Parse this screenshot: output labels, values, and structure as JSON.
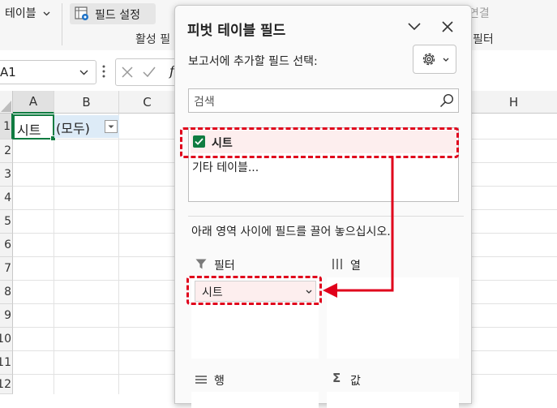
{
  "ribbon": {
    "table_dropdown_label": "테이블",
    "field_settings_label": "필드 설정",
    "active_group_label": "활성 필",
    "connect_label": "연결",
    "filter_group_label": "필터"
  },
  "formula_bar": {
    "name_box": "A1",
    "formula_prefix": "f"
  },
  "grid": {
    "columns": [
      "A",
      "B",
      "C",
      "H"
    ],
    "rows": [
      "1",
      "2",
      "3",
      "4",
      "5",
      "6",
      "7",
      "8",
      "9",
      "10",
      "11",
      "12"
    ],
    "cells": {
      "a1": "시트",
      "b1": "(모두)"
    }
  },
  "pane": {
    "title": "피벗 테이블 필드",
    "choose_fields_label": "보고서에 추가할 필드 선택:",
    "search_placeholder": "검색",
    "fields": [
      {
        "label": "시트",
        "checked": true
      }
    ],
    "more_tables_label": "기타 테이블...",
    "drag_instruction": "아래 영역 사이에 필드를 끌어 놓으십시오.",
    "areas": {
      "filter": {
        "label": "필터",
        "items": [
          "시트"
        ]
      },
      "columns": {
        "label": "열",
        "items": []
      },
      "rows": {
        "label": "행",
        "items": []
      },
      "values": {
        "label": "값",
        "items": []
      }
    }
  },
  "colors": {
    "annotation_red": "#e0001b",
    "selected_cell_border": "#107c41",
    "pivot_filter_fill": "#ddebf7"
  },
  "icons": [
    "table-dropdown-chevron-icon",
    "field-settings-icon",
    "gear-icon",
    "search-icon",
    "close-icon",
    "collapse-chevron-icon",
    "filter-funnel-icon",
    "columns-icon",
    "rows-icon",
    "sigma-icon"
  ]
}
